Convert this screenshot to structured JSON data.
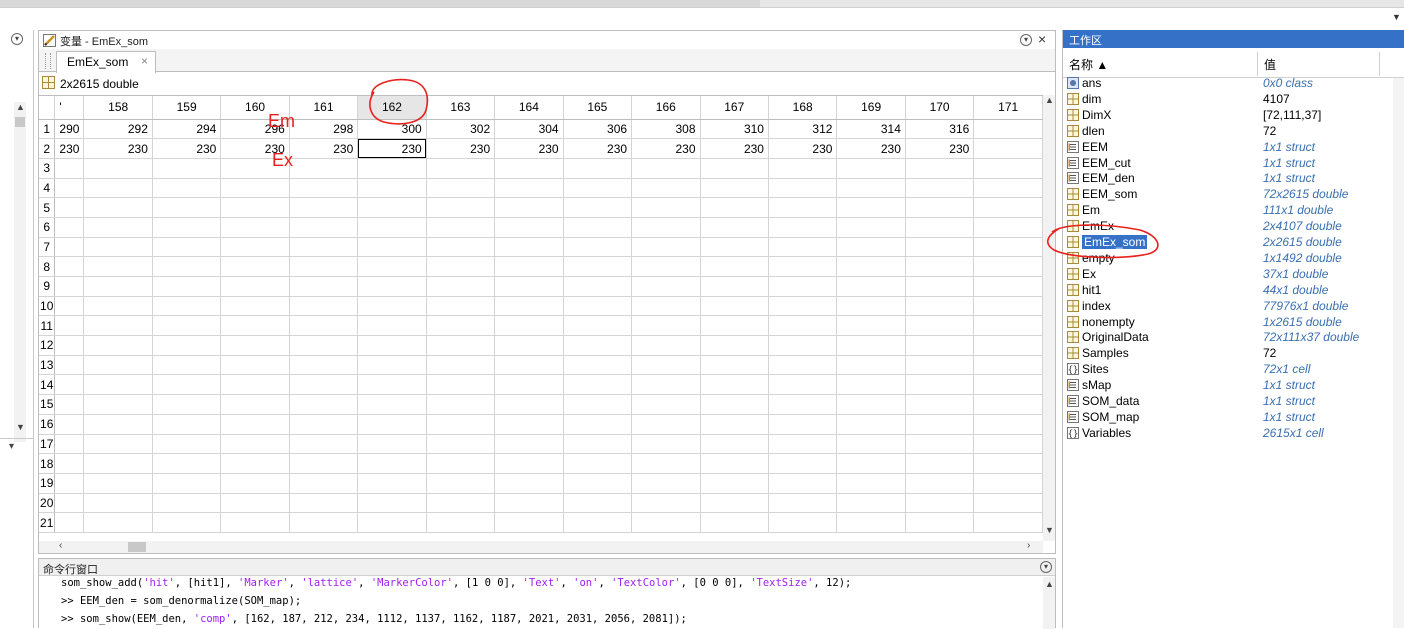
{
  "variable_editor": {
    "title": "变量 - EmEx_som",
    "tab_label": "EmEx_som",
    "info": "2x2615 double",
    "partial_col_header": "'",
    "columns": [
      "158",
      "159",
      "160",
      "161",
      "162",
      "163",
      "164",
      "165",
      "166",
      "167",
      "168",
      "169",
      "170",
      "171"
    ],
    "rows": [
      {
        "label": "1",
        "partial": "290",
        "cells": [
          "292",
          "294",
          "296",
          "298",
          "300",
          "302",
          "304",
          "306",
          "308",
          "310",
          "312",
          "314",
          "316",
          ""
        ]
      },
      {
        "label": "2",
        "partial": "230",
        "cells": [
          "230",
          "230",
          "230",
          "230",
          "230",
          "230",
          "230",
          "230",
          "230",
          "230",
          "230",
          "230",
          "230",
          ""
        ]
      },
      {
        "label": "3"
      },
      {
        "label": "4"
      },
      {
        "label": "5"
      },
      {
        "label": "6"
      },
      {
        "label": "7"
      },
      {
        "label": "8"
      },
      {
        "label": "9"
      },
      {
        "label": "10"
      },
      {
        "label": "11"
      },
      {
        "label": "12"
      },
      {
        "label": "13"
      },
      {
        "label": "14"
      },
      {
        "label": "15"
      },
      {
        "label": "16"
      },
      {
        "label": "17"
      },
      {
        "label": "18"
      },
      {
        "label": "19"
      },
      {
        "label": "20"
      },
      {
        "label": "21"
      }
    ],
    "selected_column": "162"
  },
  "annotations": {
    "em": "Em",
    "ex": "Ex"
  },
  "command_window": {
    "title": "命令行窗口",
    "lines": [
      "som_show_add('hit', [hit1], 'Marker', 'lattice', 'MarkerColor', [1 0 0], 'Text', 'on', 'TextColor', [0 0 0], 'TextSize', 12);",
      ">> EEM_den = som_denormalize(SOM_map);",
      ">> som_show(EEM_den, 'comp', [162, 187, 212, 234, 1112, 1137, 1162, 1187, 2021, 2031, 2056, 2081]);"
    ]
  },
  "workspace": {
    "title": "工作区",
    "col_name": "名称 ▲",
    "col_value": "值",
    "variables": [
      {
        "name": "ans",
        "value": "0x0 class",
        "italic": true,
        "icon": "object-icon"
      },
      {
        "name": "dim",
        "value": "4107",
        "italic": false,
        "icon": "matrix-icon"
      },
      {
        "name": "DimX",
        "value": "[72,111,37]",
        "italic": false,
        "icon": "matrix-icon"
      },
      {
        "name": "dlen",
        "value": "72",
        "italic": false,
        "icon": "matrix-icon"
      },
      {
        "name": "EEM",
        "value": "1x1 struct",
        "italic": true,
        "icon": "struct-icon"
      },
      {
        "name": "EEM_cut",
        "value": "1x1 struct",
        "italic": true,
        "icon": "struct-icon"
      },
      {
        "name": "EEM_den",
        "value": "1x1 struct",
        "italic": true,
        "icon": "struct-icon"
      },
      {
        "name": "EEM_som",
        "value": "72x2615 double",
        "italic": true,
        "icon": "matrix-icon"
      },
      {
        "name": "Em",
        "value": "111x1 double",
        "italic": true,
        "icon": "matrix-icon"
      },
      {
        "name": "EmEx",
        "value": "2x4107 double",
        "italic": true,
        "icon": "matrix-icon"
      },
      {
        "name": "EmEx_som",
        "value": "2x2615 double",
        "italic": true,
        "icon": "matrix-icon",
        "selected": true
      },
      {
        "name": "empty",
        "value": "1x1492 double",
        "italic": true,
        "icon": "matrix-icon"
      },
      {
        "name": "Ex",
        "value": "37x1 double",
        "italic": true,
        "icon": "matrix-icon"
      },
      {
        "name": "hit1",
        "value": "44x1 double",
        "italic": true,
        "icon": "matrix-icon"
      },
      {
        "name": "index",
        "value": "77976x1 double",
        "italic": true,
        "icon": "matrix-icon"
      },
      {
        "name": "nonempty",
        "value": "1x2615 double",
        "italic": true,
        "icon": "matrix-icon"
      },
      {
        "name": "OriginalData",
        "value": "72x111x37 double",
        "italic": true,
        "icon": "matrix-icon"
      },
      {
        "name": "Samples",
        "value": "72",
        "italic": false,
        "icon": "matrix-icon"
      },
      {
        "name": "Sites",
        "value": "72x1 cell",
        "italic": true,
        "icon": "cell-icon"
      },
      {
        "name": "sMap",
        "value": "1x1 struct",
        "italic": true,
        "icon": "struct-icon"
      },
      {
        "name": "SOM_data",
        "value": "1x1 struct",
        "italic": true,
        "icon": "struct-icon"
      },
      {
        "name": "SOM_map",
        "value": "1x1 struct",
        "italic": true,
        "icon": "struct-icon"
      },
      {
        "name": "Variables",
        "value": "2615x1 cell",
        "italic": true,
        "icon": "cell-icon"
      }
    ]
  },
  "colors": {
    "accent": "#3572c7",
    "annotation": "#e8211c",
    "italic_value": "#3a6fb0",
    "string": "#a020f0"
  }
}
